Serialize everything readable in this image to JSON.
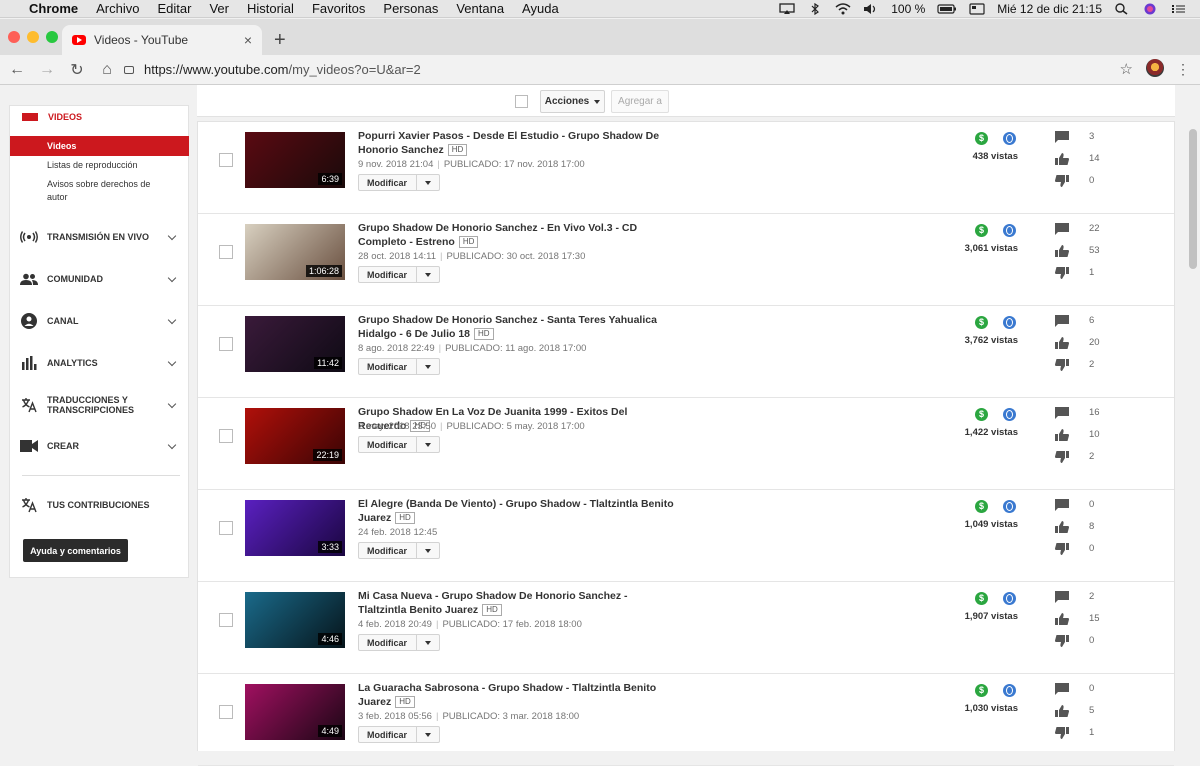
{
  "menubar": {
    "apple": "",
    "app": "Chrome",
    "items": [
      "Archivo",
      "Editar",
      "Ver",
      "Historial",
      "Favoritos",
      "Personas",
      "Ventana",
      "Ayuda"
    ],
    "battery": "100 %",
    "datetime": "Mié 12 de dic  21:15"
  },
  "browser": {
    "tab_title": "Videos - YouTube",
    "url_host": "https://www.youtube.com",
    "url_path": "/my_videos?o=U&ar=2"
  },
  "actionbar": {
    "acciones": "Acciones",
    "agregar": "Agregar a"
  },
  "sidebar": {
    "videos_heading": "VIDEOS",
    "sub_items": [
      "Videos",
      "Listas de reproducción",
      "Avisos sobre derechos de autor"
    ],
    "sections": [
      {
        "label": "TRANSMISIÓN EN VIVO",
        "icon": "live-icon"
      },
      {
        "label": "COMUNIDAD",
        "icon": "people-icon"
      },
      {
        "label": "CANAL",
        "icon": "account-icon"
      },
      {
        "label": "ANALYTICS",
        "icon": "bar-chart-icon"
      },
      {
        "label": "TRADUCCIONES Y TRANSCRIPCIONES",
        "icon": "translate-icon"
      },
      {
        "label": "CREAR",
        "icon": "camera-icon"
      }
    ],
    "contributions": "TUS CONTRIBUCIONES",
    "feedback": "Ayuda y comentarios"
  },
  "videos": [
    {
      "title": "Popurri Xavier Pasos - Desde El Estudio - Grupo Shadow De Honorio Sanchez",
      "hd": "HD",
      "uploaded": "9 nov. 2018 21:04",
      "published": "PUBLICADO: 17 nov. 2018 17:00",
      "duration": "6:39",
      "views": "438 vistas",
      "comments": "3",
      "likes": "14",
      "dislikes": "0",
      "thumb": [
        "#5a0a12",
        "#1a0a0a"
      ]
    },
    {
      "title": "Grupo Shadow De Honorio Sanchez - En Vivo Vol.3 - CD Completo - Estreno",
      "hd": "HD",
      "uploaded": "28 oct. 2018 14:11",
      "published": "PUBLICADO: 30 oct. 2018 17:30",
      "duration": "1:06:28",
      "views": "3,061 vistas",
      "comments": "22",
      "likes": "53",
      "dislikes": "1",
      "thumb": [
        "#d8d0c0",
        "#6a5040"
      ]
    },
    {
      "title": "Grupo Shadow De Honorio Sanchez - Santa Teres Yahualica Hidalgo - 6 De Julio 18",
      "hd": "HD",
      "uploaded": "8 ago. 2018 22:49",
      "published": "PUBLICADO: 11 ago. 2018 17:00",
      "duration": "11:42",
      "views": "3,762 vistas",
      "comments": "6",
      "likes": "20",
      "dislikes": "2",
      "thumb": [
        "#3a1a3a",
        "#0e0a14"
      ]
    },
    {
      "title": "Grupo Shadow En La Voz De Juanita 1999 - Exitos Del Recuerdo",
      "hd": "HD",
      "uploaded": "2 may. 2018 23:50",
      "published": "PUBLICADO: 5 may. 2018 17:00",
      "duration": "22:19",
      "views": "1,422 vistas",
      "comments": "16",
      "likes": "10",
      "dislikes": "2",
      "thumb": [
        "#b0100a",
        "#3a0404"
      ]
    },
    {
      "title": "El Alegre (Banda De Viento) - Grupo Shadow - Tlaltzintla Benito Juarez",
      "hd": "HD",
      "uploaded": "24 feb. 2018 12:45",
      "published": "",
      "duration": "3:33",
      "views": "1,049 vistas",
      "comments": "0",
      "likes": "8",
      "dislikes": "0",
      "thumb": [
        "#5a20c0",
        "#1a0640"
      ]
    },
    {
      "title": "Mi Casa Nueva - Grupo Shadow De Honorio Sanchez - Tlaltzintla Benito Juarez",
      "hd": "HD",
      "uploaded": "4 feb. 2018 20:49",
      "published": "PUBLICADO: 17 feb. 2018 18:00",
      "duration": "4:46",
      "views": "1,907 vistas",
      "comments": "2",
      "likes": "15",
      "dislikes": "0",
      "thumb": [
        "#1a6a8a",
        "#06141a"
      ]
    },
    {
      "title": "La Guaracha Sabrosona - Grupo Shadow - Tlaltzintla Benito Juarez",
      "hd": "HD",
      "uploaded": "3 feb. 2018 05:56",
      "published": "PUBLICADO: 3 mar. 2018 18:00",
      "duration": "4:49",
      "views": "1,030 vistas",
      "comments": "0",
      "likes": "5",
      "dislikes": "1",
      "thumb": [
        "#a01060",
        "#1a0614"
      ]
    }
  ],
  "row_labels": {
    "modify": "Modificar",
    "money_icon": "monetization-icon",
    "globe_icon": "public-icon"
  },
  "colors": {
    "accent": "#cc181e",
    "money": "#2ba640",
    "globe": "#3a79d0"
  }
}
